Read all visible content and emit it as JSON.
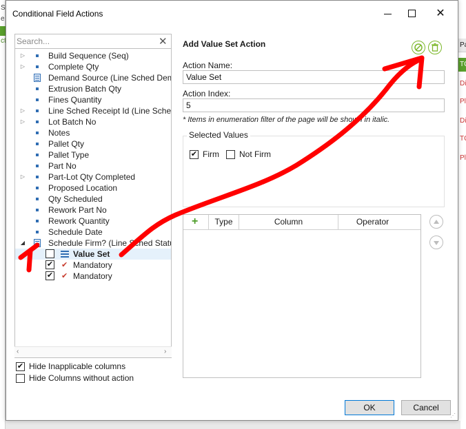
{
  "dialog": {
    "title": "Conditional Field Actions",
    "ok_label": "OK",
    "cancel_label": "Cancel"
  },
  "search": {
    "placeholder": "Search...",
    "clear_icon": "close-icon"
  },
  "tree": {
    "items": [
      {
        "label": "Build Sequence (Seq)",
        "icon": "field-icon",
        "expandable": true
      },
      {
        "label": "Complete Qty",
        "icon": "field-icon",
        "expandable": true
      },
      {
        "label": "Demand Source (Line Sched Demand",
        "icon": "record-icon",
        "expandable": false
      },
      {
        "label": "Extrusion Batch Qty",
        "icon": "field-icon",
        "expandable": false
      },
      {
        "label": "Fines Quantity",
        "icon": "field-icon",
        "expandable": false
      },
      {
        "label": "Line Sched Receipt Id (Line Schedule",
        "icon": "field-icon",
        "expandable": true
      },
      {
        "label": "Lot Batch No",
        "icon": "field-icon",
        "expandable": true
      },
      {
        "label": "Notes",
        "icon": "field-icon",
        "expandable": false
      },
      {
        "label": "Pallet Qty",
        "icon": "field-icon",
        "expandable": false
      },
      {
        "label": "Pallet Type",
        "icon": "field-icon",
        "expandable": false
      },
      {
        "label": "Part No",
        "icon": "field-icon",
        "expandable": false
      },
      {
        "label": "Part-Lot Qty Completed",
        "icon": "field-icon",
        "expandable": true
      },
      {
        "label": "Proposed Location",
        "icon": "field-icon",
        "expandable": false
      },
      {
        "label": "Qty Scheduled",
        "icon": "field-icon",
        "expandable": false
      },
      {
        "label": "Rework Part No",
        "icon": "field-icon",
        "expandable": false
      },
      {
        "label": "Rework Quantity",
        "icon": "field-icon",
        "expandable": false
      },
      {
        "label": "Schedule Date",
        "icon": "field-icon",
        "expandable": false
      },
      {
        "label": "Schedule Firm? (Line Sched Status)",
        "icon": "record-icon",
        "expandable": true,
        "expanded": true
      }
    ],
    "children": [
      {
        "label": "Value Set",
        "checked": false,
        "bold": true,
        "icon": "list-icon"
      },
      {
        "label": "Mandatory",
        "checked": true,
        "bold": false,
        "icon": "checkmark-icon"
      },
      {
        "label": "Mandatory",
        "checked": true,
        "bold": false,
        "icon": "checkmark-icon"
      }
    ]
  },
  "options": {
    "hide_inapplicable": {
      "label": "Hide Inapplicable columns",
      "checked": true
    },
    "hide_without_action": {
      "label": "Hide Columns without action",
      "checked": false
    }
  },
  "action": {
    "section_title": "Add Value Set Action",
    "name_label": "Action Name:",
    "name_value": "Value Set",
    "index_label": "Action Index:",
    "index_value": "5",
    "note": "* Items in enumeration filter of the page will be shown in italic.",
    "selected_values_title": "Selected Values",
    "values": [
      {
        "label": "Firm",
        "checked": true
      },
      {
        "label": "Not Firm",
        "checked": false
      }
    ],
    "grid_columns": [
      "Type",
      "Column",
      "Operator"
    ]
  },
  "colors": {
    "accent_green": "#7cb72a",
    "annotation_red": "#ff0000",
    "tree_icon_blue": "#2f6db3"
  },
  "background_app": {
    "right_header": "Pa",
    "right_items": [
      "TC",
      "Di",
      "Pl",
      "Di",
      "TC",
      "Pl"
    ],
    "left_chars": [
      "e",
      "S",
      "ct"
    ]
  }
}
